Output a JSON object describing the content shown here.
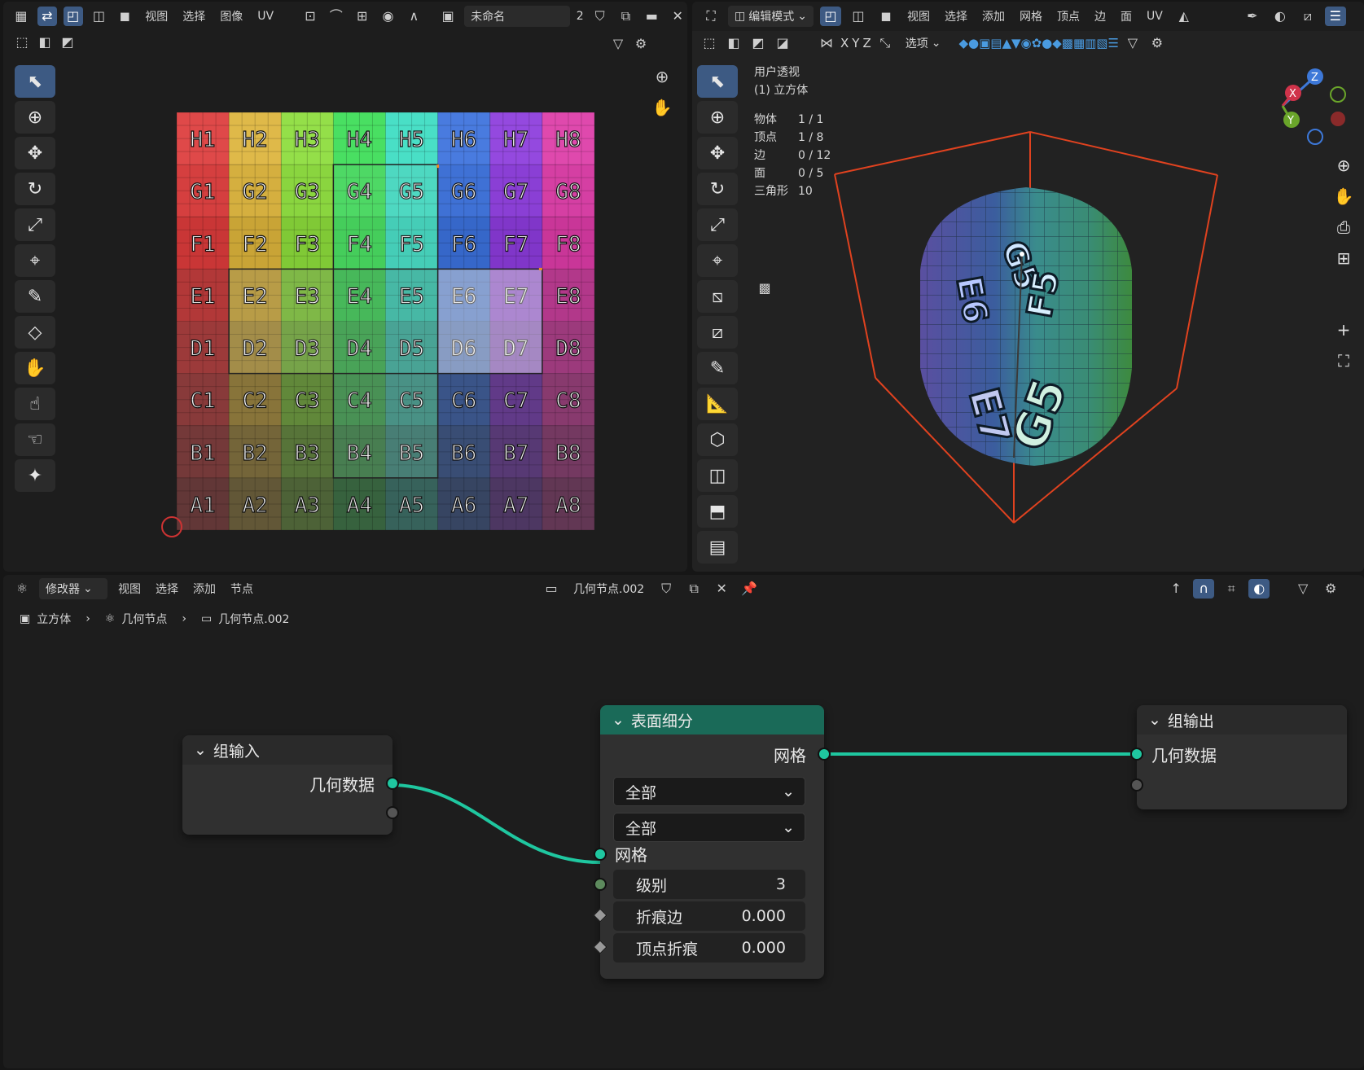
{
  "uv": {
    "menus": [
      "视图",
      "选择",
      "图像",
      "UV"
    ],
    "image_name": "未命名",
    "users": "2",
    "rows": [
      "H",
      "G",
      "F",
      "E",
      "D",
      "C",
      "B",
      "A"
    ],
    "cols": [
      "1",
      "2",
      "3",
      "4",
      "5",
      "6",
      "7",
      "8"
    ]
  },
  "view3d": {
    "mode": "编辑模式",
    "menus": [
      "视图",
      "选择",
      "添加",
      "网格",
      "顶点",
      "边",
      "面",
      "UV"
    ],
    "axes": [
      "X",
      "Y",
      "Z"
    ],
    "options": "选项",
    "view_name": "用户透视",
    "object_name": "(1) 立方体",
    "stats": [
      {
        "k": "物体",
        "v": "1 / 1"
      },
      {
        "k": "顶点",
        "v": "1 / 8"
      },
      {
        "k": "边",
        "v": "0 / 12"
      },
      {
        "k": "面",
        "v": "0 / 5"
      },
      {
        "k": "三角形",
        "v": "10"
      }
    ],
    "gizmo": {
      "z": "Z",
      "x": "X",
      "y": "Y"
    },
    "cube_labels": [
      "G5",
      "E6",
      "F5",
      "E7",
      "G5"
    ]
  },
  "node_editor": {
    "editor": "修改器",
    "menus": [
      "视图",
      "选择",
      "添加",
      "节点"
    ],
    "tree_name": "几何节点.002",
    "breadcrumb": [
      "立方体",
      "几何节点",
      "几何节点.002"
    ],
    "group_input": {
      "title": "组输入",
      "out": "几何数据"
    },
    "subdiv": {
      "title": "表面细分",
      "out": "网格",
      "select1": "全部",
      "select2": "全部",
      "in_mesh": "网格",
      "level_label": "级别",
      "level": "3",
      "crease_edge_label": "折痕边",
      "crease_edge": "0.000",
      "vertex_crease_label": "顶点折痕",
      "vertex_crease": "0.000"
    },
    "group_output": {
      "title": "组输出",
      "in": "几何数据"
    }
  },
  "colors": {
    "accent": "#3d5a83",
    "link": "#1fc7a0",
    "header_green": "#1a6a58"
  }
}
